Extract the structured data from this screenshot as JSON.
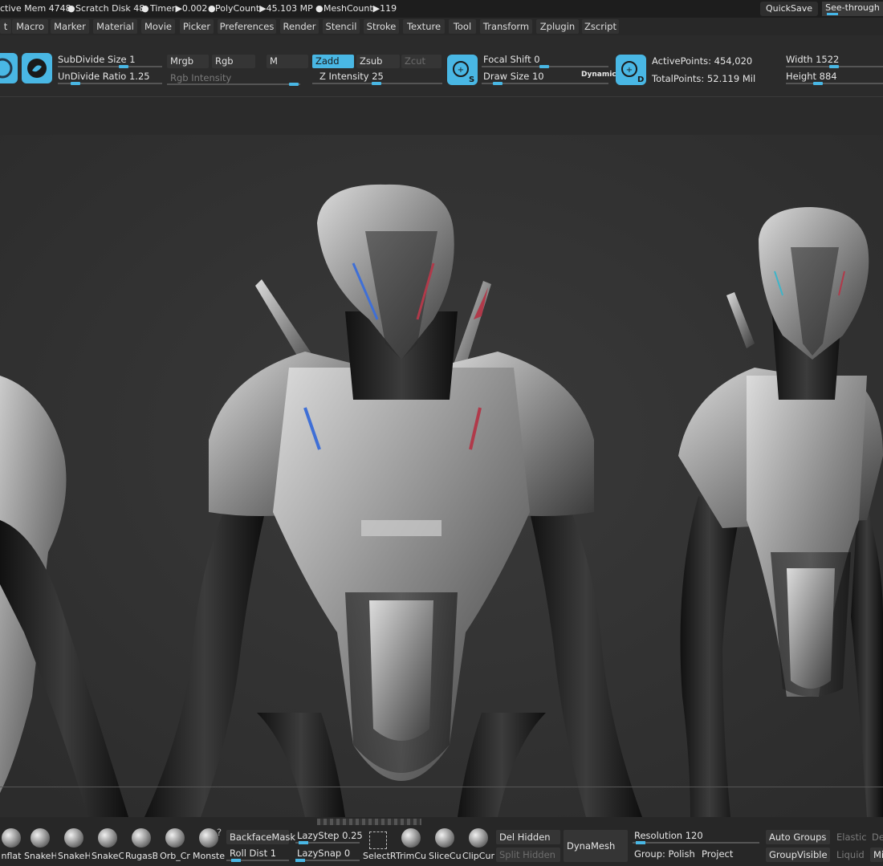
{
  "status": {
    "active_mem": "ctive Mem 4748",
    "scratch_disk": "Scratch Disk 48",
    "timer": "Timer▶0.002",
    "polycount": "PolyCount▶45.103 MP",
    "meshcount": "MeshCount▶119",
    "quicksave": "QuickSave",
    "see_through": "See-through",
    "bullet": "●"
  },
  "menu": [
    "t",
    "Macro",
    "Marker",
    "Material",
    "Movie",
    "Picker",
    "Preferences",
    "Render",
    "Stencil",
    "Stroke",
    "Texture",
    "Tool",
    "Transform",
    "Zplugin",
    "Zscript"
  ],
  "toolbar": {
    "subdivide_size": "SubDivide Size 1",
    "undivide_ratio": "UnDivide Ratio 1.25",
    "mrgb": "Mrgb",
    "rgb": "Rgb",
    "m": "M",
    "rgb_intensity": "Rgb Intensity",
    "zadd": "Zadd",
    "zsub": "Zsub",
    "zcut": "Zcut",
    "z_intensity": "Z Intensity 25",
    "focal_shift": "Focal Shift 0",
    "draw_size": "Draw Size 10",
    "dynamic": "Dynamic",
    "active_points": "ActivePoints: 454,020",
    "total_points": "TotalPoints: 52.119 Mil",
    "width": "Width 1522",
    "height": "Height 884",
    "s_letter": "S",
    "d_letter": "D"
  },
  "bottom": {
    "brushes": [
      "nflat",
      "SnakeH",
      "SnakeH",
      "SnakeC",
      "RugasB",
      "Orb_Cr",
      "Monste"
    ],
    "backface_mask": "BackfaceMask",
    "roll_dist": "Roll Dist 1",
    "lazy_step": "LazyStep 0.25",
    "lazy_snap": "LazySnap 0",
    "select_r": "SelectR",
    "trim_cu": "TrimCu",
    "slice_cu": "SliceCu",
    "clip_cur": "ClipCur",
    "del_hidden": "Del Hidden",
    "split_hidden": "Split Hidden",
    "dynamesh": "DynaMesh",
    "resolution": "Resolution 120",
    "group_polish": "Group: Polish",
    "project": "Project",
    "auto_groups": "Auto Groups",
    "group_visible": "GroupVisible",
    "elastic": "Elastic",
    "liquid": "Liquid",
    "de": "De",
    "mi": "Mi",
    "question": "?"
  }
}
